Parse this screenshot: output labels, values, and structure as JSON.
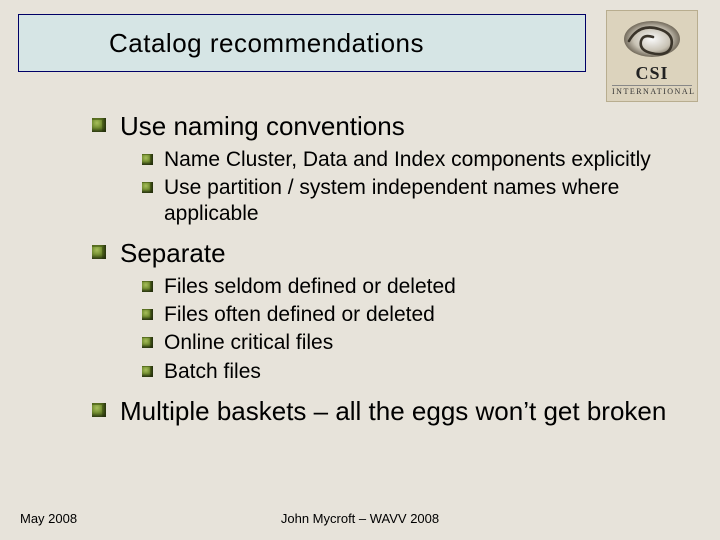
{
  "title": "Catalog recommendations",
  "logo": {
    "name": "CSI",
    "sub": "INTERNATIONAL"
  },
  "bullets": {
    "b1": "Use naming conventions",
    "b1_1": "Name Cluster, Data and Index components explicitly",
    "b1_2": "Use partition / system independent names where applicable",
    "b2": "Separate",
    "b2_1": "Files seldom defined or deleted",
    "b2_2": "Files often defined or deleted",
    "b2_3": "Online critical files",
    "b2_4": "Batch files",
    "b3": "Multiple baskets – all the eggs won’t get broken"
  },
  "footer": {
    "date": "May 2008",
    "author": "John Mycroft – WAVV 2008"
  }
}
